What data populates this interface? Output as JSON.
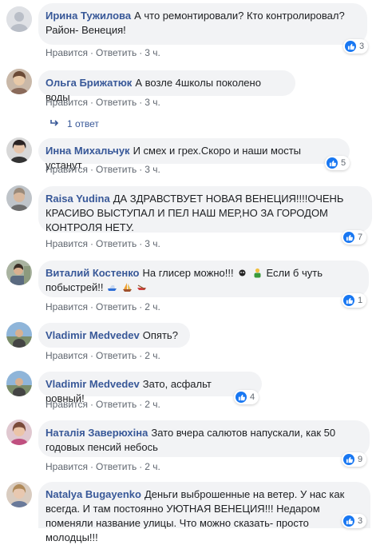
{
  "actions": {
    "like": "Нравится",
    "reply": "Ответить",
    "separator": "·"
  },
  "comments": [
    {
      "author": "Ирина Тужилова",
      "text": "А что ремонтировали? Кто контролировал? Район- Венеция!",
      "time": "3 ч.",
      "reactions": "3"
    },
    {
      "author": "Ольга Брижатюк",
      "text": "А возле 4школы поколено воды",
      "time": "3 ч.",
      "replies": "1 ответ"
    },
    {
      "author": "Инна Михальчук",
      "text": "И смех и грех.Скоро и наши мосты устанут",
      "time": "3 ч.",
      "reactions": "5"
    },
    {
      "author": "Raisa Yudina",
      "text": "ДА ЗДРАВСТВУЕТ НОВАЯ ВЕНЕЦИЯ!!!!ОЧЕНЬ КРАСИВО ВЫСТУПАЛ И ПЕЛ НАШ МЕР,НО ЗА ГОРОДОМ КОНТРОЛЯ НЕТУ.",
      "time": "3 ч.",
      "reactions": "7"
    },
    {
      "author": "Виталий Костенко",
      "text_a": "На глисер можно!!!",
      "text_b": "Если б чуть побыстрей!!",
      "time": "2 ч.",
      "reactions": "1"
    },
    {
      "author": "Vladimir Medvedev",
      "text": "Опять?",
      "time": "2 ч."
    },
    {
      "author": "Vladimir Medvedev",
      "text": "Зато, асфальт ровный!",
      "time": "2 ч.",
      "reactions": "4"
    },
    {
      "author": "Наталія Заверюхіна",
      "text": "Зато вчера салютов напускали, как 50 годовых пенсий небось",
      "time": "2 ч.",
      "reactions": "9"
    },
    {
      "author": "Natalya Bugayenko",
      "text": "Деньги выброшенные на ветер. У нас как всегда. И там постоянно УЮТНАЯ ВЕНЕЦИЯ!!! Недаром поменяли название улицы. Что можно сказать- просто молодцы!!!",
      "reactions": "3"
    }
  ],
  "colors": {
    "author": "#385898",
    "bubble": "#f2f3f5",
    "like": "#1877f2",
    "meta": "#606770"
  }
}
